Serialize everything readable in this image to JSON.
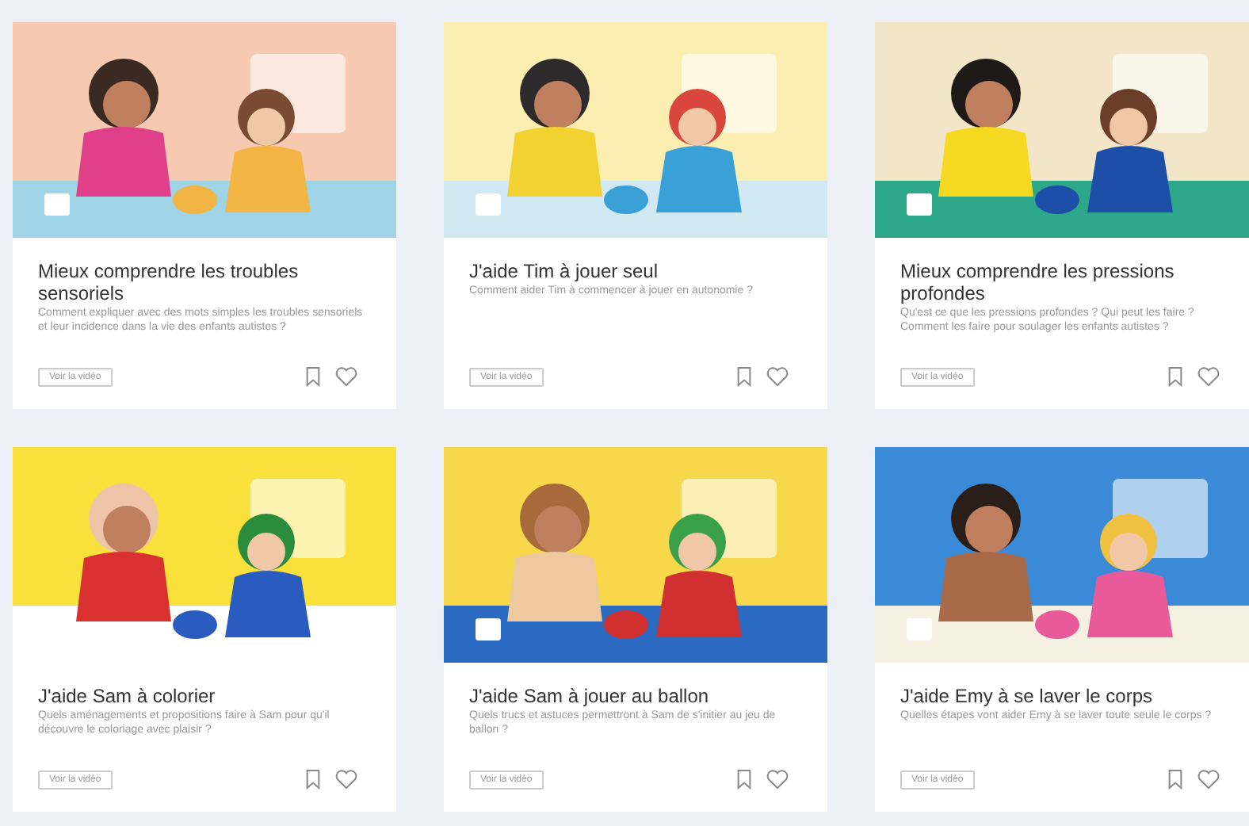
{
  "cards": [
    {
      "title": "Mieux comprendre les troubles sensoriels",
      "description": "Comment expliquer avec des mots simples les troubles sensoriels et leur incidence dans la vie des enfants autistes ?",
      "button": "Voir la vidéo"
    },
    {
      "title": "J'aide Tim à jouer seul",
      "description": "Comment aider Tim à commencer à jouer en autonomie ?",
      "button": "Voir la vidéo"
    },
    {
      "title": "Mieux comprendre les pressions profondes",
      "description": "Qu'est ce que les pressions profondes ? Qui peut les faire ? Comment les faire pour soulager les enfants autistes ?",
      "button": "Voir la vidéo"
    },
    {
      "title": "J'aide Sam à colorier",
      "description": "Quels aménagements et propositions faire à Sam pour qu'il découvre le coloriage avec plaisir ?",
      "button": "Voir la vidéo"
    },
    {
      "title": "J'aide Sam à jouer au ballon",
      "description": "Quels trucs et astuces permettront à Sam de s'initier au jeu de ballon ?",
      "button": "Voir la vidéo"
    },
    {
      "title": "J'aide Emy à se laver le corps",
      "description": "Quelles étapes vont aider Emy à se laver toute seule le corps ?",
      "button": "Voir la vidéo"
    }
  ]
}
